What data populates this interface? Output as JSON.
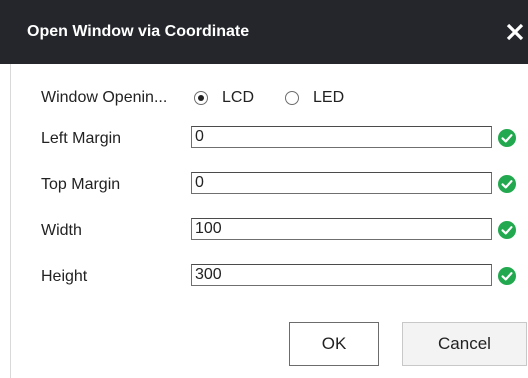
{
  "dialog": {
    "title": "Open Window via Coordinate",
    "close_icon": "close-icon"
  },
  "window_opening": {
    "label": "Window Openin...",
    "options": [
      {
        "label": "LCD",
        "checked": true
      },
      {
        "label": "LED",
        "checked": false
      }
    ]
  },
  "fields": [
    {
      "label": "Left Margin",
      "value": "0",
      "status_icon": "valid-check-icon"
    },
    {
      "label": "Top Margin",
      "value": "0",
      "status_icon": "valid-check-icon"
    },
    {
      "label": "Width",
      "value": "100",
      "status_icon": "valid-check-icon"
    },
    {
      "label": "Height",
      "value": "300",
      "status_icon": "valid-check-icon"
    }
  ],
  "buttons": {
    "ok_label": "OK",
    "cancel_label": "Cancel"
  },
  "colors": {
    "titlebar": "#24262b",
    "valid_check": "#22a84e"
  }
}
